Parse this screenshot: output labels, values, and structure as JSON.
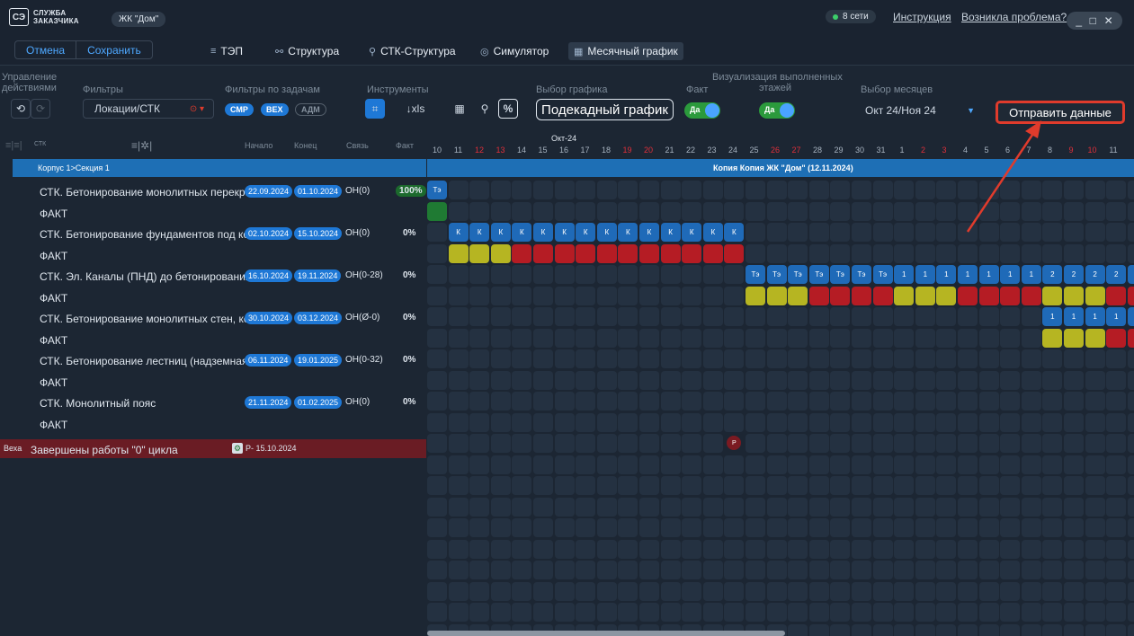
{
  "app": {
    "logo_mark": "СЭ",
    "logo_line1": "СЛУЖБА",
    "logo_line2": "ЗАКАЗЧИКА",
    "project": "ЖК \"Дом\"",
    "online": "8 сети",
    "instruction": "Инструкция",
    "problem": "Возникла проблема?",
    "win": [
      "_",
      "□",
      "✕"
    ]
  },
  "toolbar": {
    "cancel": "Отмена",
    "save": "Сохранить",
    "tabs": [
      {
        "label": "ТЭП",
        "icon": "≡"
      },
      {
        "label": "Структура",
        "icon": "⚯"
      },
      {
        "label": "СТК-Структура",
        "icon": "⚲"
      },
      {
        "label": "Симулятор",
        "icon": "◎"
      },
      {
        "label": "Месячный график",
        "icon": "▦"
      }
    ]
  },
  "controls": {
    "manage_label_1": "Управление",
    "manage_label_2": "действиями",
    "filters_label": "Фильтры",
    "filters_value": "Локации/СТК",
    "task_filters_label": "Фильтры по задачам",
    "pill_smr": "СМР",
    "pill_vek": "ВЕХ",
    "pill_adm": "АДМ",
    "tools_label": "Инструменты",
    "xls": "↓xls",
    "percent": "%",
    "schedule_label": "Выбор графика",
    "schedule_value": "Подекадный график",
    "fact_label": "Факт",
    "fact_toggle": "Да",
    "vis_label_1": "Визуализация выполненных",
    "vis_label_2": "этажей",
    "vis_toggle": "Да",
    "months_label": "Выбор месяцев",
    "months_value": "Окт 24/Ноя 24",
    "send": "Отправить данные"
  },
  "grid": {
    "col_stk": "СТК",
    "col_start": "Начало",
    "col_end": "Конец",
    "col_link": "Связь",
    "col_fact": "Факт",
    "section": "Корпус 1>Секция 1",
    "band_title": "Копия Копия ЖК \"Дом\" (12.11.2024)",
    "month": "Окт-24",
    "days": [
      "10",
      "11",
      "12",
      "13",
      "14",
      "15",
      "16",
      "17",
      "18",
      "19",
      "20",
      "21",
      "22",
      "23",
      "24",
      "25",
      "26",
      "27",
      "28",
      "29",
      "30",
      "31",
      "1",
      "2",
      "3",
      "4",
      "5",
      "6",
      "7",
      "8",
      "9",
      "10",
      "11"
    ],
    "rows": [
      {
        "name": "СТК. Бетонирование монолитных перекр...",
        "start": "22.09.2024",
        "end": "01.10.2024",
        "link": "ОН(0)",
        "fact": "100%"
      },
      {
        "name": "ФАКТ"
      },
      {
        "name": "СТК. Бетонирование фундаментов под ко...",
        "start": "02.10.2024",
        "end": "15.10.2024",
        "link": "ОН(0)",
        "fact": "0%"
      },
      {
        "name": "ФАКТ"
      },
      {
        "name": "СТК. Эл. Каналы (ПНД) до бетонирования",
        "start": "16.10.2024",
        "end": "19.11.2024",
        "link": "ОН(0-28)",
        "fact": "0%"
      },
      {
        "name": "ФАКТ"
      },
      {
        "name": "СТК. Бетонирование монолитных стен, ко...",
        "start": "30.10.2024",
        "end": "03.12.2024",
        "link": "ОН(Ø-0)",
        "fact": "0%"
      },
      {
        "name": "ФАКТ"
      },
      {
        "name": "СТК. Бетонирование лестниц (надземная...",
        "start": "06.11.2024",
        "end": "19.01.2025",
        "link": "ОН(0-32)",
        "fact": "0%"
      },
      {
        "name": "ФАКТ"
      },
      {
        "name": "СТК. Монолитный пояс",
        "start": "21.11.2024",
        "end": "01.02.2025",
        "link": "ОН(0)",
        "fact": "0%"
      },
      {
        "name": "ФАКТ"
      }
    ],
    "milestone": {
      "tag": "Веха",
      "name": "Завершены работы \"0\" цикла",
      "date": "Р- 15.10.2024",
      "marker": "Р"
    },
    "cell_labels": {
      "te": "Тэ",
      "k": "К",
      "one": "1",
      "two": "2"
    }
  },
  "colors": {
    "accent": "#1e78d6",
    "olive": "#b6b522",
    "red": "#b51c24",
    "green": "#1f7a33",
    "highlight": "#e03b2c"
  }
}
